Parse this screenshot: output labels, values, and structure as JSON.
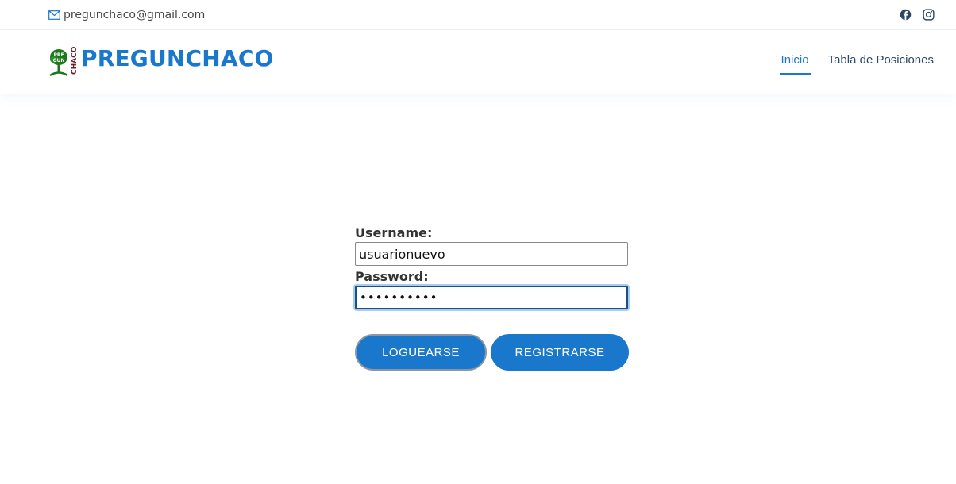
{
  "topbar": {
    "email": "pregunchaco@gmail.com",
    "socials": [
      "facebook-icon",
      "instagram-icon"
    ]
  },
  "header": {
    "brand": "PREGUNCHACO",
    "logo_text": [
      "PRE",
      "GUN",
      "CHACO"
    ],
    "nav": [
      {
        "label": "Inicio",
        "active": true
      },
      {
        "label": "Tabla de Posiciones",
        "active": false
      }
    ]
  },
  "form": {
    "username_label": "Username:",
    "username_value": "usuarionuevo",
    "password_label": "Password:",
    "password_value": "••••••••••",
    "login_button": "LOGUEARSE",
    "register_button": "REGISTRARSE"
  },
  "colors": {
    "accent": "#1977cc",
    "nav_text": "#2c4964",
    "logo_green": "#1c7a1c"
  }
}
